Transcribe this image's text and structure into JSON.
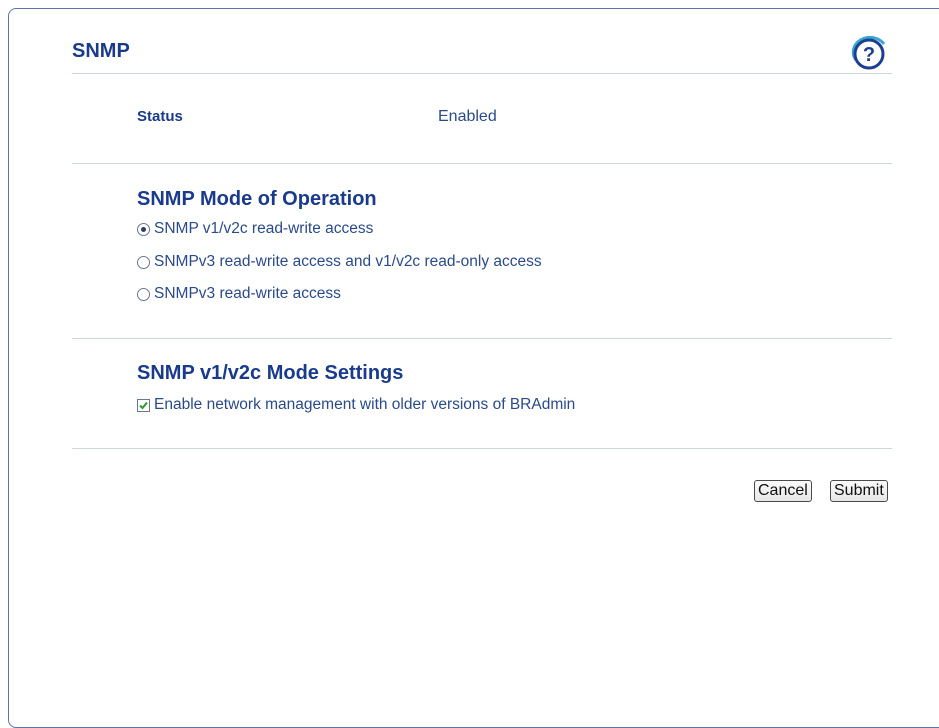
{
  "header": {
    "title": "SNMP",
    "help_icon": "help-question-icon"
  },
  "status": {
    "label": "Status",
    "value": "Enabled"
  },
  "mode_section": {
    "title": "SNMP Mode of Operation",
    "options": [
      {
        "label": "SNMP v1/v2c read-write access",
        "selected": true
      },
      {
        "label": "SNMPv3 read-write access and v1/v2c read-only access",
        "selected": false
      },
      {
        "label": "SNMPv3 read-write access",
        "selected": false
      }
    ]
  },
  "v1v2c_section": {
    "title": "SNMP v1/v2c Mode Settings",
    "checkbox_label": "Enable network management with older versions of BRAdmin",
    "checkbox_checked": true
  },
  "actions": {
    "cancel_label": "Cancel",
    "submit_label": "Submit"
  },
  "colors": {
    "title": "#1a3b8c",
    "check": "#2e9a2e"
  }
}
